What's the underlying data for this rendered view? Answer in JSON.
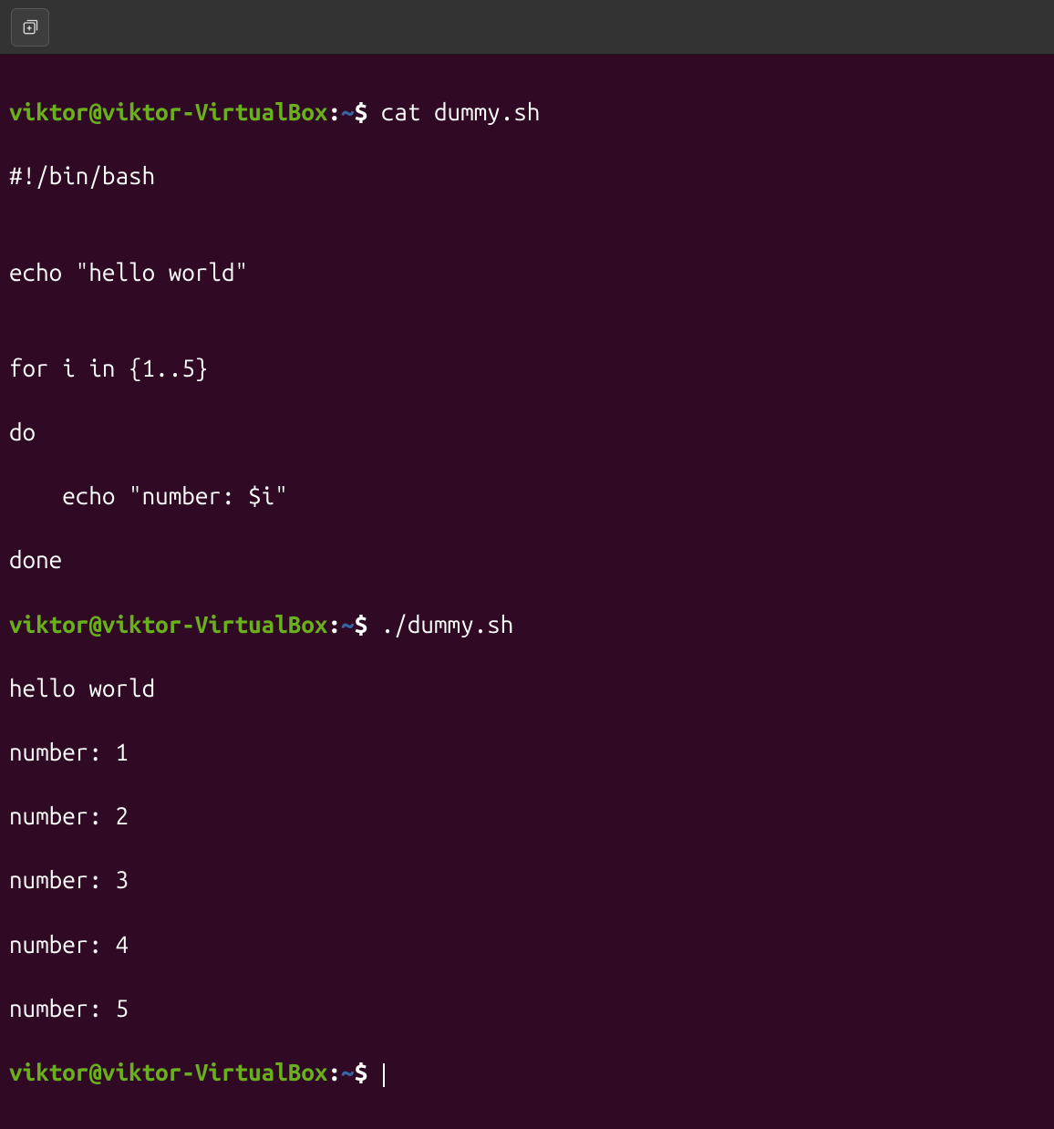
{
  "titlebar": {
    "new_tab_tooltip": "New Tab"
  },
  "prompt": {
    "user_host": "viktor@viktor-VirtualBox",
    "separator": ":",
    "path": "~",
    "symbol": "$"
  },
  "session": {
    "cmd1": "cat dummy.sh",
    "out1_l1": "#!/bin/bash",
    "out1_l2": "",
    "out1_l3": "echo \"hello world\"",
    "out1_l4": "",
    "out1_l5": "for i in {1..5}",
    "out1_l6": "do",
    "out1_l7": "    echo \"number: $i\"",
    "out1_l8": "done",
    "cmd2": "./dummy.sh",
    "out2_l1": "hello world",
    "out2_l2": "number: 1",
    "out2_l3": "number: 2",
    "out2_l4": "number: 3",
    "out2_l5": "number: 4",
    "out2_l6": "number: 5"
  }
}
